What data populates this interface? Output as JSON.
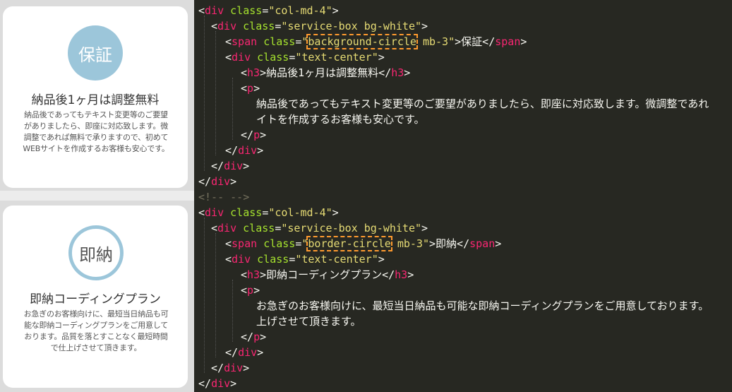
{
  "cards": [
    {
      "circle_label": "保証",
      "title": "納品後1ヶ月は調整無料",
      "body_lines": [
        "納品後であってもテキスト変更等のご要望",
        "がありましたら、即座に対応致します。微",
        "調整であれば無料で承りますので、初めて",
        "WEBサイトを作成するお客様も安心です。"
      ]
    },
    {
      "circle_label": "即納",
      "title": "即納コーディングプラン",
      "body_lines": [
        "お急ぎのお客様向けに、最短当日納品も可",
        "能な即納コーディングプランをご用意して",
        "おります。品質を落とすことなく最短時間",
        "で仕上げさせて頂きます。"
      ]
    }
  ],
  "code": {
    "l1": {
      "open": "<",
      "tag": "div",
      "sp": " ",
      "attr": "class",
      "eq": "=",
      "val": "\"col-md-4\"",
      "close": ">"
    },
    "l2": {
      "open": "<",
      "tag": "div",
      "sp": " ",
      "attr": "class",
      "eq": "=",
      "val": "\"service-box bg-white\"",
      "close": ">"
    },
    "l3": {
      "open": "<",
      "tag": "span",
      "sp": " ",
      "attr": "class",
      "eq": "=",
      "q": "\"",
      "hl": "background-circle",
      "rest": " mb-3\"",
      "close": ">",
      "text": "保証",
      "end_open": "</",
      "end_tag": "span",
      "end_close": ">"
    },
    "l4": {
      "open": "<",
      "tag": "div",
      "sp": " ",
      "attr": "class",
      "eq": "=",
      "val": "\"text-center\"",
      "close": ">"
    },
    "l5": {
      "open": "<",
      "tag": "h3",
      "close": ">",
      "text": "納品後1ヶ月は調整無料",
      "end_open": "</",
      "end_tag": "h3",
      "end_close": ">"
    },
    "l6": {
      "open": "<",
      "tag": "p",
      "close": ">"
    },
    "l7": "納品後であってもテキスト変更等のご要望がありましたら、即座に対応致します。微調整であれ",
    "l8": "イトを作成するお客様も安心です。",
    "l9": {
      "open": "</",
      "tag": "p",
      "close": ">"
    },
    "l10": {
      "open": "</",
      "tag": "div",
      "close": ">"
    },
    "l11": {
      "open": "</",
      "tag": "div",
      "close": ">"
    },
    "l12": {
      "open": "</",
      "tag": "div",
      "close": ">"
    },
    "l13": "<!-- -->",
    "l14": {
      "open": "<",
      "tag": "div",
      "sp": " ",
      "attr": "class",
      "eq": "=",
      "val": "\"col-md-4\"",
      "close": ">"
    },
    "l15": {
      "open": "<",
      "tag": "div",
      "sp": " ",
      "attr": "class",
      "eq": "=",
      "val": "\"service-box bg-white\"",
      "close": ">"
    },
    "l16": {
      "open": "<",
      "tag": "span",
      "sp": " ",
      "attr": "class",
      "eq": "=",
      "q": "\"",
      "hl": "border-circle",
      "rest": " mb-3\"",
      "close": ">",
      "text": "即納",
      "end_open": "</",
      "end_tag": "span",
      "end_close": ">"
    },
    "l17": {
      "open": "<",
      "tag": "div",
      "sp": " ",
      "attr": "class",
      "eq": "=",
      "val": "\"text-center\"",
      "close": ">"
    },
    "l18": {
      "open": "<",
      "tag": "h3",
      "close": ">",
      "text": "即納コーディングプラン",
      "end_open": "</",
      "end_tag": "h3",
      "end_close": ">"
    },
    "l19": {
      "open": "<",
      "tag": "p",
      "close": ">"
    },
    "l20": "お急ぎのお客様向けに、最短当日納品も可能な即納コーディングプランをご用意しております。",
    "l21": "上げさせて頂きます。",
    "l22": {
      "open": "</",
      "tag": "p",
      "close": ">"
    },
    "l23": {
      "open": "</",
      "tag": "div",
      "close": ">"
    },
    "l24": {
      "open": "</",
      "tag": "div",
      "close": ">"
    },
    "l25": {
      "open": "</",
      "tag": "div",
      "close": ">"
    }
  },
  "colors": {
    "editor_bg": "#272822",
    "tag": "#f92672",
    "attr": "#a6e22e",
    "string": "#e6db74",
    "comment": "#75715e",
    "highlight_dash": "#ff9a2e",
    "circle": "#9cc6da"
  }
}
